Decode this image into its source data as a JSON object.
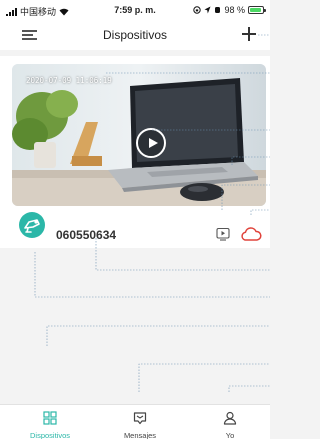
{
  "status_bar": {
    "carrier": "中国移动",
    "time": "7:59 p. m.",
    "battery_percent": "98 %"
  },
  "header": {
    "title": "Dispositivos"
  },
  "device": {
    "timestamp": "2020-07-09 11:06:19",
    "id": "060550634"
  },
  "tabs": [
    {
      "label": "Dispositivos",
      "icon": "grid-icon",
      "active": true
    },
    {
      "label": "Mensajes",
      "icon": "message-icon",
      "active": false
    },
    {
      "label": "Yo",
      "icon": "person-icon",
      "active": false
    }
  ],
  "colors": {
    "accent": "#2bb7a8",
    "cloud": "#e0433b",
    "battery": "#4cd964"
  }
}
